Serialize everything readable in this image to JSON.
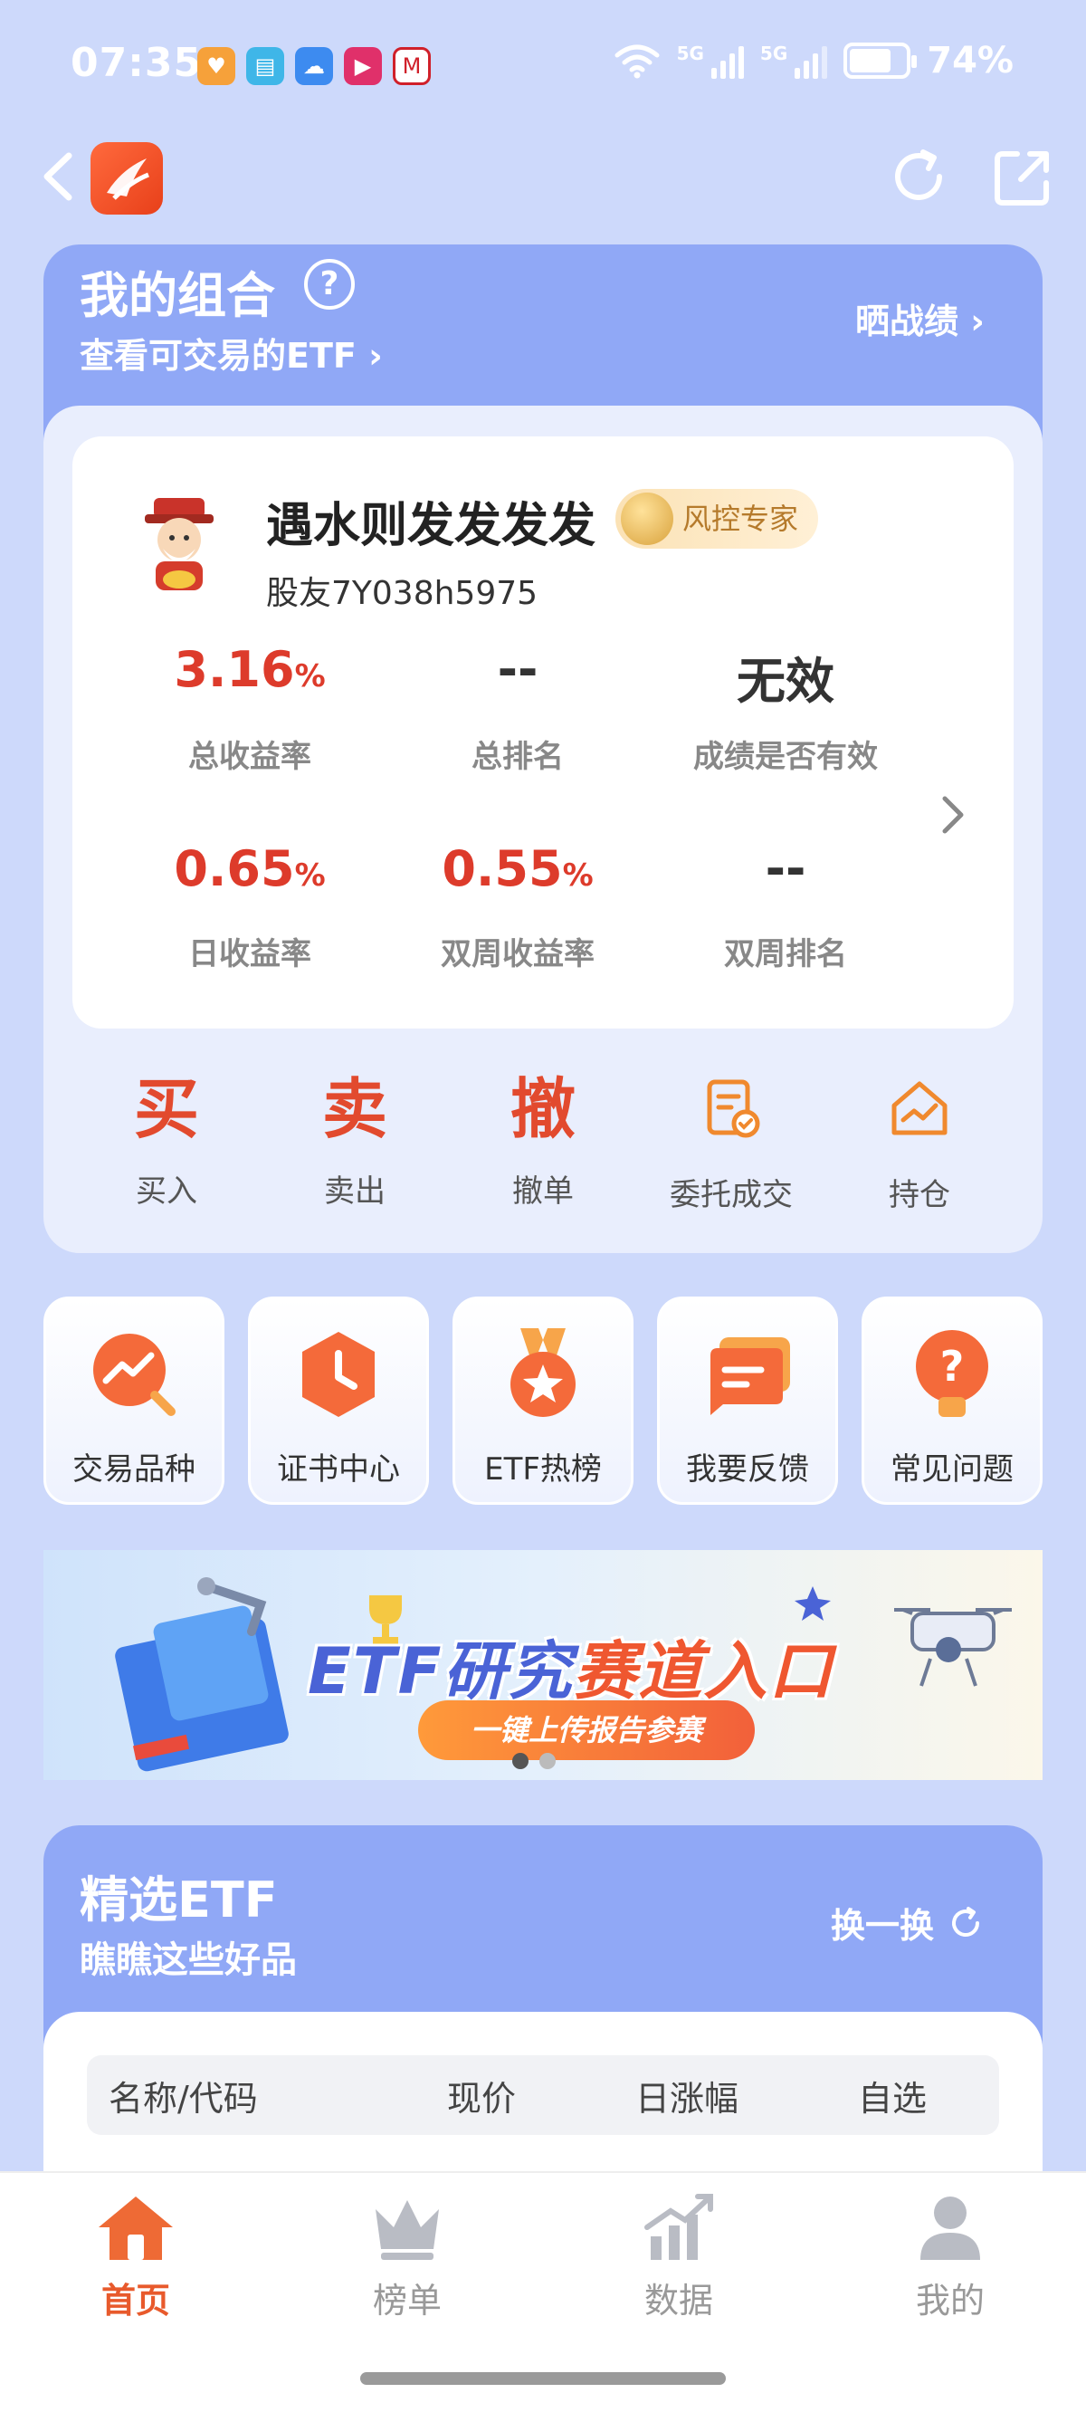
{
  "status_bar": {
    "time": "07:35",
    "network_1": "5G",
    "network_2": "5G",
    "wifi_tag": "6",
    "battery": "74%",
    "battery_level": 0.74,
    "app_badges": [
      "heart-app",
      "book-app",
      "weather-app",
      "video-app",
      "bank-app"
    ]
  },
  "nav": {
    "back": "chevron-left-icon",
    "refresh": "refresh-icon",
    "share": "share-icon"
  },
  "portfolio": {
    "title": "我的组合",
    "etf_link": "查看可交易的ETF",
    "share_result": "晒战绩",
    "user_name": "遇水则发发发发",
    "badge": "风控专家",
    "user_id": "股友7Y038h5975",
    "stats": [
      {
        "value": "3.16",
        "unit": "%",
        "label": "总收益率"
      },
      {
        "value": "--",
        "unit": "",
        "label": "总排名"
      },
      {
        "value": "无效",
        "unit": "",
        "label": "成绩是否有效"
      },
      {
        "value": "0.65",
        "unit": "%",
        "label": "日收益率"
      },
      {
        "value": "0.55",
        "unit": "%",
        "label": "双周收益率"
      },
      {
        "value": "--",
        "unit": "",
        "label": "双周排名"
      }
    ],
    "actions": [
      {
        "glyph": "买",
        "label": "买入"
      },
      {
        "glyph": "卖",
        "label": "卖出"
      },
      {
        "glyph": "撤",
        "label": "撤单"
      },
      {
        "glyph": "",
        "label": "委托成交"
      },
      {
        "glyph": "",
        "label": "持仓"
      }
    ]
  },
  "tiles": [
    {
      "label": "交易品种",
      "icon": "trend-search-icon"
    },
    {
      "label": "证书中心",
      "icon": "clock-badge-icon"
    },
    {
      "label": "ETF热榜",
      "icon": "medal-star-icon"
    },
    {
      "label": "我要反馈",
      "icon": "chat-bubble-icon"
    },
    {
      "label": "常见问题",
      "icon": "question-bulb-icon"
    }
  ],
  "banner": {
    "title_part1": "ETF研究",
    "title_part2": "赛道入口",
    "button": "一键上传报告参赛",
    "slide_count": 2,
    "active_slide": 1
  },
  "featured": {
    "title": "精选ETF",
    "subtitle": "瞧瞧这些好品",
    "swap": "换一换",
    "columns": [
      "名称/代码",
      "现价",
      "日涨幅",
      "自选"
    ]
  },
  "tabbar": [
    {
      "label": "首页",
      "active": true
    },
    {
      "label": "榜单",
      "active": false
    },
    {
      "label": "数据",
      "active": false
    },
    {
      "label": "我的",
      "active": false
    }
  ],
  "colors": {
    "accent": "#e85a2c",
    "header_blue": "#90a8f6",
    "page_bg": "#cdd9fb",
    "gain_red": "#dd3b2b"
  }
}
